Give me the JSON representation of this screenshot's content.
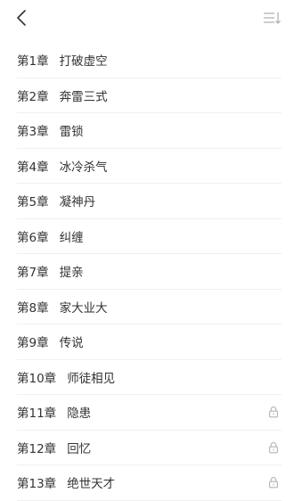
{
  "header": {
    "back_icon": "chevron-left-icon",
    "sort_icon": "sort-list-icon"
  },
  "colors": {
    "text": "#333333",
    "divider": "#f0f0f0",
    "icon": "#b3b3b3"
  },
  "chapters": [
    {
      "number": "第1章",
      "title": "打破虚空",
      "locked": false
    },
    {
      "number": "第2章",
      "title": "奔雷三式",
      "locked": false
    },
    {
      "number": "第3章",
      "title": "雷锁",
      "locked": false
    },
    {
      "number": "第4章",
      "title": "冰冷杀气",
      "locked": false
    },
    {
      "number": "第5章",
      "title": "凝神丹",
      "locked": false
    },
    {
      "number": "第6章",
      "title": "纠缠",
      "locked": false
    },
    {
      "number": "第7章",
      "title": "提亲",
      "locked": false
    },
    {
      "number": "第8章",
      "title": "家大业大",
      "locked": false
    },
    {
      "number": "第9章",
      "title": "传说",
      "locked": false
    },
    {
      "number": "第10章",
      "title": "师徒相见",
      "locked": false
    },
    {
      "number": "第11章",
      "title": "隐患",
      "locked": true
    },
    {
      "number": "第12章",
      "title": "回忆",
      "locked": true
    },
    {
      "number": "第13章",
      "title": "绝世天才",
      "locked": true
    }
  ]
}
